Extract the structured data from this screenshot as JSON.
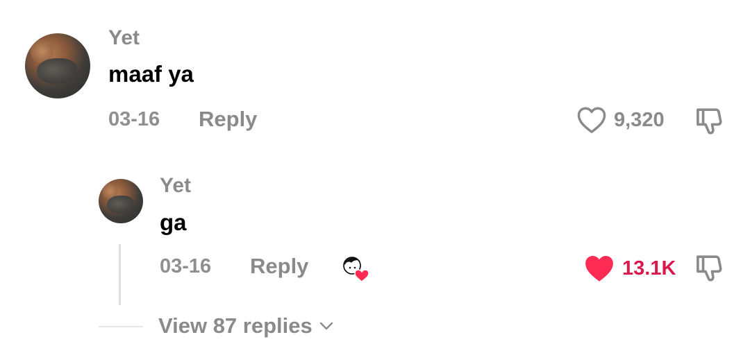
{
  "comments": [
    {
      "username": "Yet",
      "text": "maaf ya",
      "date": "03-16",
      "reply_label": "Reply",
      "likes": "9,320",
      "liked": false,
      "icons": {
        "like": "heart-outline-icon",
        "dislike": "thumbs-down-icon"
      }
    },
    {
      "username": "Yet",
      "text": "ga",
      "date": "03-16",
      "reply_label": "Reply",
      "likes": "13.1K",
      "liked": true,
      "liked_by_creator": true,
      "icons": {
        "like": "heart-filled-icon",
        "dislike": "thumbs-down-icon",
        "creator": "creator-liked-badge-icon"
      }
    }
  ],
  "view_replies_label": "View 87 replies",
  "colors": {
    "like_active": "#fe2c55",
    "like_count_active": "#d9184c",
    "muted": "#8a8a8a"
  }
}
